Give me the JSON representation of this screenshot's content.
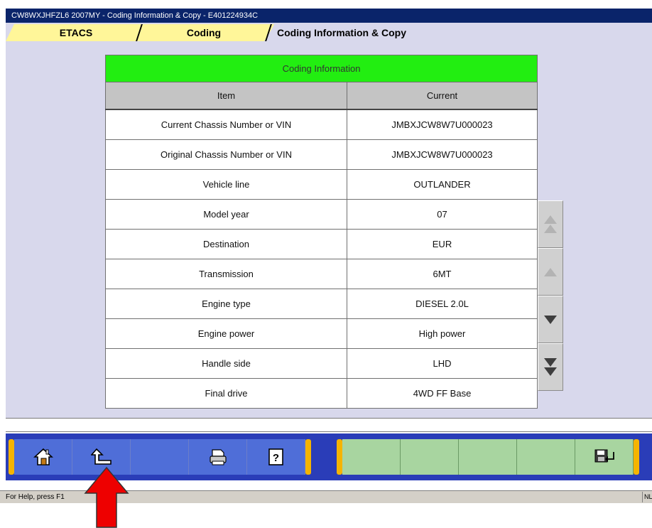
{
  "window": {
    "title": "CW8WXJHFZL6 2007MY   -  Coding Information & Copy   -  E401224934C"
  },
  "tabs": [
    {
      "label": "ETACS"
    },
    {
      "label": "Coding"
    },
    {
      "label": "Coding Information & Copy"
    }
  ],
  "coding_table": {
    "title": "Coding Information",
    "headers": {
      "item": "Item",
      "current": "Current"
    },
    "rows": [
      {
        "item": "Current Chassis Number or VIN",
        "current": "JMBXJCW8W7U000023"
      },
      {
        "item": "Original Chassis Number or VIN",
        "current": "JMBXJCW8W7U000023"
      },
      {
        "item": "Vehicle line",
        "current": "OUTLANDER"
      },
      {
        "item": "Model year",
        "current": "07"
      },
      {
        "item": "Destination",
        "current": "EUR"
      },
      {
        "item": "Transmission",
        "current": "6MT"
      },
      {
        "item": "Engine type",
        "current": "DIESEL 2.0L"
      },
      {
        "item": "Engine power",
        "current": "High power"
      },
      {
        "item": "Handle side",
        "current": "LHD"
      },
      {
        "item": "Final drive",
        "current": "4WD FF Base"
      }
    ]
  },
  "scroll_buttons": [
    "page-up",
    "line-up",
    "line-down",
    "page-down"
  ],
  "toolbar": {
    "left_buttons": [
      "home-icon",
      "back-arrow-icon",
      "",
      "printer-icon",
      "help-icon"
    ],
    "right_buttons": [
      "",
      "",
      "",
      "",
      "save-exit-icon"
    ]
  },
  "status": {
    "help_text": "For Help, press F1",
    "indicator": "NL"
  },
  "colors": {
    "title_bar": "#0a246a",
    "panel_bg": "#d8d8ec",
    "table_title": "#22ee11",
    "toolbar_bg": "#2a3db8",
    "toolbar_button": "#4f6ed8",
    "toolbar_green": "#a8d5a0",
    "accent_cap": "#f5b400",
    "annotation_arrow": "#ee0000"
  }
}
